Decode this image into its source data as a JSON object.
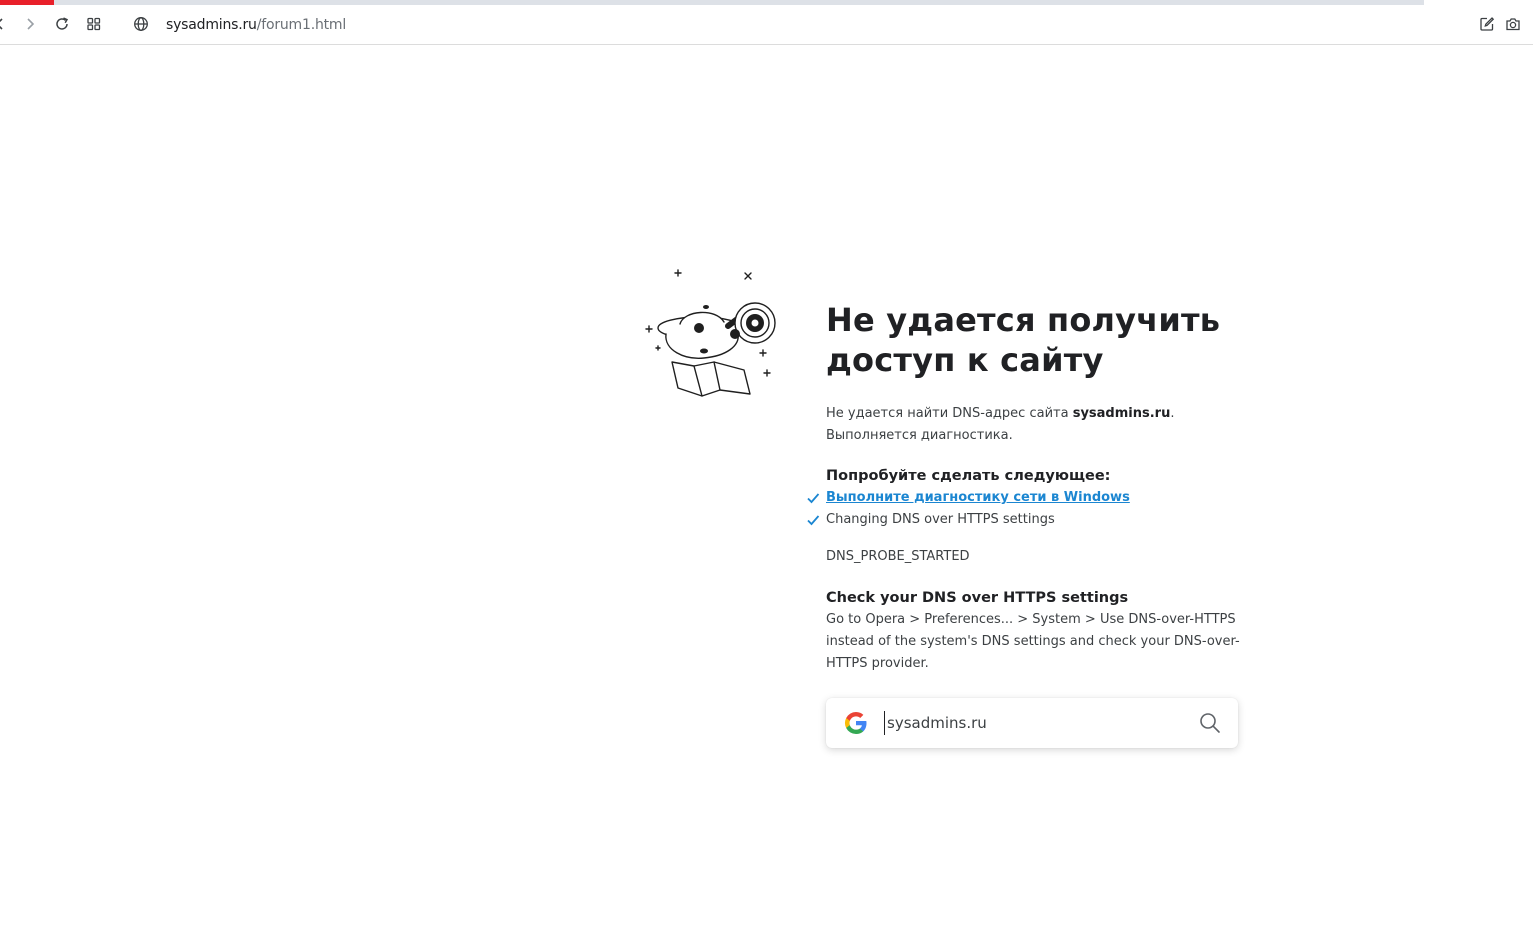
{
  "browser": {
    "url_host": "sysadmins.ru",
    "url_path": "/forum1.html",
    "load_progress": 0.038,
    "colors": {
      "progress": "#e8202a",
      "track": "#dde1e7"
    }
  },
  "error": {
    "title": "Не удается получить доступ к сайту",
    "desc_prefix": "Не удается найти DNS-адрес сайта ",
    "desc_host": "sysadmins.ru",
    "desc_suffix": ". Выполняется диагностика.",
    "suggest_heading": "Попробуйте сделать следующее:",
    "suggestions": [
      {
        "text": "Выполните диагностику сети в Windows",
        "link": true
      },
      {
        "text": "Changing DNS over HTTPS settings",
        "link": false
      }
    ],
    "error_code": "DNS_PROBE_STARTED",
    "doh_heading": "Check your DNS over HTTPS settings",
    "doh_text": "Go to Opera > Preferences... > System > Use DNS-over-HTTPS instead of the system's DNS settings and check your DNS-over-HTTPS provider."
  },
  "search": {
    "value": "sysadmins.ru"
  },
  "icons": {
    "back": "back-icon",
    "forward": "forward-icon",
    "reload": "reload-icon",
    "tabs": "tab-grid-icon",
    "site": "globe-icon",
    "edit": "edit-icon",
    "snapshot": "camera-icon",
    "search": "search-icon",
    "google": "google-logo"
  }
}
